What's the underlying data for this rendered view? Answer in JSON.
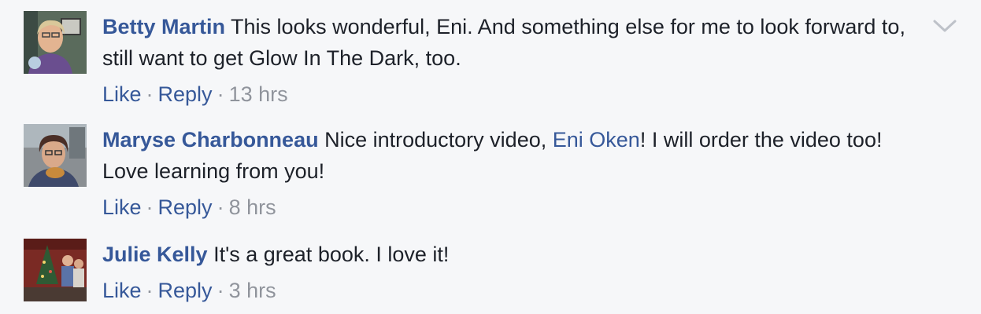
{
  "comments": [
    {
      "author": "Betty Martin",
      "text_before": "This looks wonderful, Eni. And something else for me to look forward to, still want to get Glow In The Dark, too.",
      "mention": "",
      "text_after": "",
      "like_label": "Like",
      "reply_label": "Reply",
      "separator": "·",
      "time": "13 hrs"
    },
    {
      "author": "Maryse Charbonneau",
      "text_before": "Nice introductory video,",
      "mention": "Eni Oken",
      "text_after": "! I will order the video too! Love learning from you!",
      "like_label": "Like",
      "reply_label": "Reply",
      "separator": "·",
      "time": "8 hrs"
    },
    {
      "author": "Julie Kelly",
      "text_before": "It's a great book. I love it!",
      "mention": "",
      "text_after": "",
      "like_label": "Like",
      "reply_label": "Reply",
      "separator": "·",
      "time": "3 hrs"
    }
  ],
  "options_icon": "chevron-down-icon",
  "colors": {
    "background": "#f6f7f9",
    "link": "#365899",
    "text": "#1d2129",
    "meta": "#90949c"
  }
}
